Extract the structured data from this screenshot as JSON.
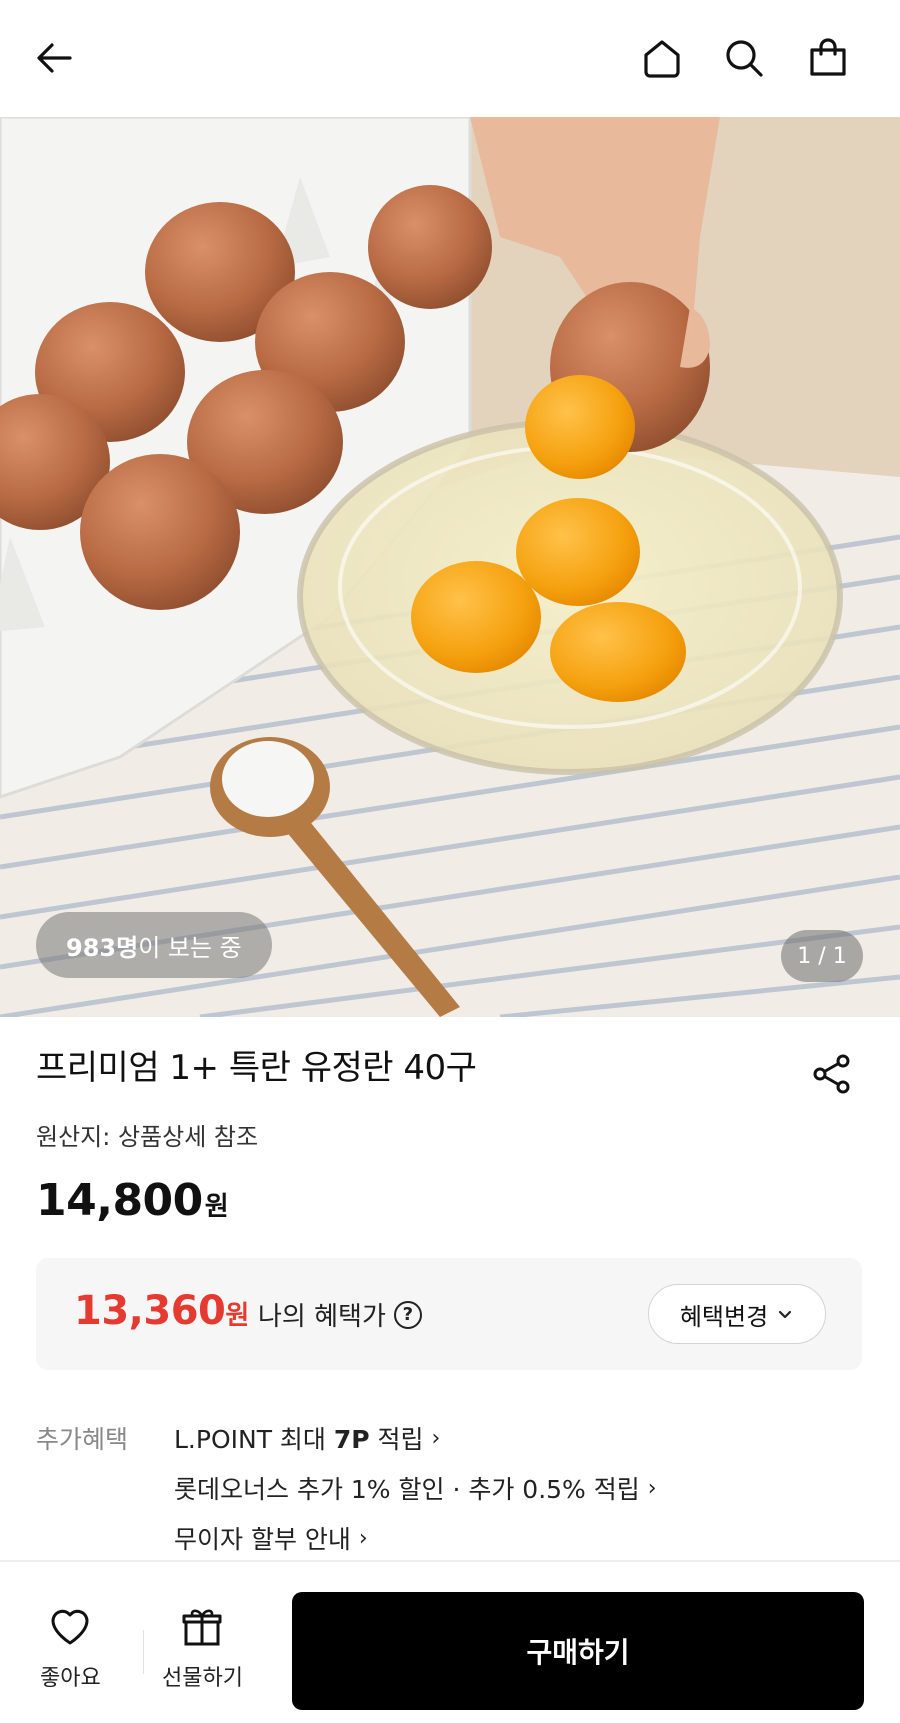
{
  "header": {
    "icons": [
      "back-arrow-icon",
      "home-icon",
      "search-icon",
      "shopping-bag-icon"
    ]
  },
  "gallery": {
    "viewers_count": "983명",
    "viewers_suffix": "이 보는 중",
    "page_indicator": "1 / 1"
  },
  "product": {
    "title": "프리미엄 1+ 특란 유정란 40구",
    "origin": "원산지: 상품상세 참조",
    "price": "14,800",
    "price_unit": "원"
  },
  "benefit": {
    "price": "13,360",
    "price_unit": "원",
    "label": "나의 혜택가",
    "help": "?",
    "change_button": "혜택변경",
    "accent_color": "#e43a2f"
  },
  "extra_benefits": {
    "label": "추가혜택",
    "items": [
      {
        "prefix": "L.POINT 최대 ",
        "bold": "7P",
        "suffix": " 적립",
        "chevron": "›"
      },
      {
        "text": "롯데오너스 추가 1% 할인 · 추가 0.5% 적립",
        "chevron": "›"
      },
      {
        "text": "무이자 할부 안내",
        "chevron": "›"
      }
    ]
  },
  "bottom_bar": {
    "like_label": "좋아요",
    "gift_label": "선물하기",
    "buy_label": "구매하기"
  }
}
